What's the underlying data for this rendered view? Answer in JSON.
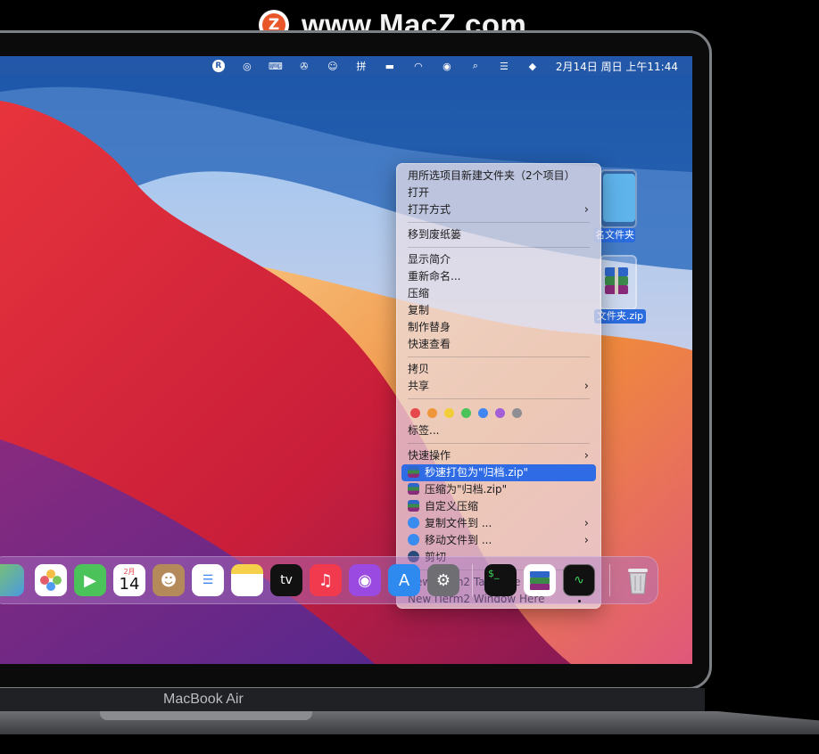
{
  "watermark": {
    "logo_letter": "Z",
    "text": "www.MacZ.com"
  },
  "menubar": {
    "icons": [
      "R",
      "◎",
      "⌨",
      "✇",
      "☺",
      "拼",
      "▬",
      "◠",
      "◉",
      "⌕",
      "☰",
      "◆"
    ],
    "clock": "2月14日 周日 上午11:44"
  },
  "desktop": {
    "folder_label": "名文件夹",
    "zip_label": "文件夹.zip"
  },
  "context_menu": {
    "group1": [
      "用所选项目新建文件夹（2个项目）",
      "打开",
      "打开方式"
    ],
    "group2": [
      "移到废纸篓"
    ],
    "group3": [
      "显示简介",
      "重新命名...",
      "压缩",
      "复制",
      "制作替身",
      "快速查看"
    ],
    "group4": [
      "拷贝",
      "共享"
    ],
    "tag_colors": [
      "#e5484d",
      "#f0963a",
      "#f2cd3a",
      "#4cc35a",
      "#3f86f0",
      "#a45ed6",
      "#8e8e93"
    ],
    "tags_label": "标签...",
    "group6": [
      "快速操作",
      "秒速打包为\"归档.zip\"",
      "压缩为\"归档.zip\"",
      "自定义压缩",
      "复制文件到 ...",
      "移动文件到 ...",
      "剪切"
    ],
    "group7": [
      "New iTerm2 Tab Here",
      "New iTerm2 Window Here"
    ]
  },
  "dock": {
    "calendar_month": "2月",
    "calendar_day": "14",
    "tv_label": "tv",
    "terminal_label": "$_"
  },
  "laptop": {
    "model": "MacBook Air"
  }
}
